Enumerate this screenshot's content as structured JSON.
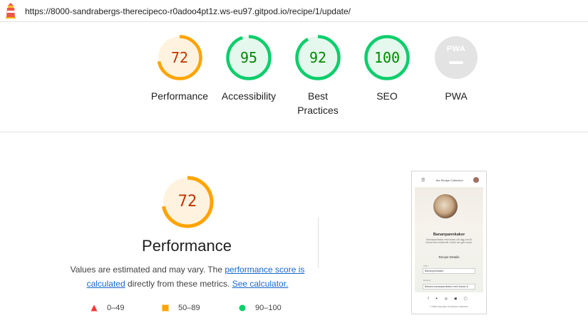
{
  "url": "https://8000-sandrabergs-therecipeco-r0adoo4pt1z.ws-eu97.gitpod.io/recipe/1/update/",
  "gauges": [
    {
      "score": "72",
      "label": "Performance",
      "value": 72,
      "color": "#ffa400",
      "bg": "#fff3e0",
      "text_color": "#c33300"
    },
    {
      "score": "95",
      "label": "Accessibility",
      "value": 95,
      "color": "#0cce6b",
      "bg": "#e5f8ee",
      "text_color": "#008800"
    },
    {
      "score": "92",
      "label": "Best\nPractices",
      "value": 92,
      "color": "#0cce6b",
      "bg": "#e5f8ee",
      "text_color": "#008800"
    },
    {
      "score": "100",
      "label": "SEO",
      "value": 100,
      "color": "#0cce6b",
      "bg": "#e5f8ee",
      "text_color": "#008800"
    },
    {
      "score": "",
      "label": "PWA",
      "value": 0,
      "color": "#d6d6d6",
      "bg": "#e3e3e3",
      "text_color": "#ffffff",
      "badge": "PWA"
    }
  ],
  "performance": {
    "score": "72",
    "value": 72,
    "title": "Performance",
    "desc_prefix": "Values are estimated and may vary. The ",
    "link_score": "performance score is calculated",
    "desc_middle": " directly from these metrics. ",
    "link_calc": "See calculator.",
    "legend": [
      {
        "shape": "triangle",
        "color": "#ff3333",
        "range": "0–49"
      },
      {
        "shape": "square",
        "color": "#ffa400",
        "range": "50–89"
      },
      {
        "shape": "circle",
        "color": "#0cce6b",
        "range": "90–100"
      }
    ]
  },
  "thumbnail": {
    "brand": "the Recipe Collection",
    "recipe_title": "Bananpannkakor",
    "recipe_text": "Bananpannkakor med banan och ägg, bra till frukost eller mellanmål. Enkelt och gott recept.",
    "section": "Recipe Details",
    "field1_label": "Title*",
    "field1_value": "Bananpannkakor",
    "field2_label": "Excerpt",
    "field2_value": "Banana bananpannkakor med banan &",
    "social": "f ✦ ◎ ▣ ◯",
    "copyright": "© 2023 Copyright: the Recipe Collection"
  }
}
